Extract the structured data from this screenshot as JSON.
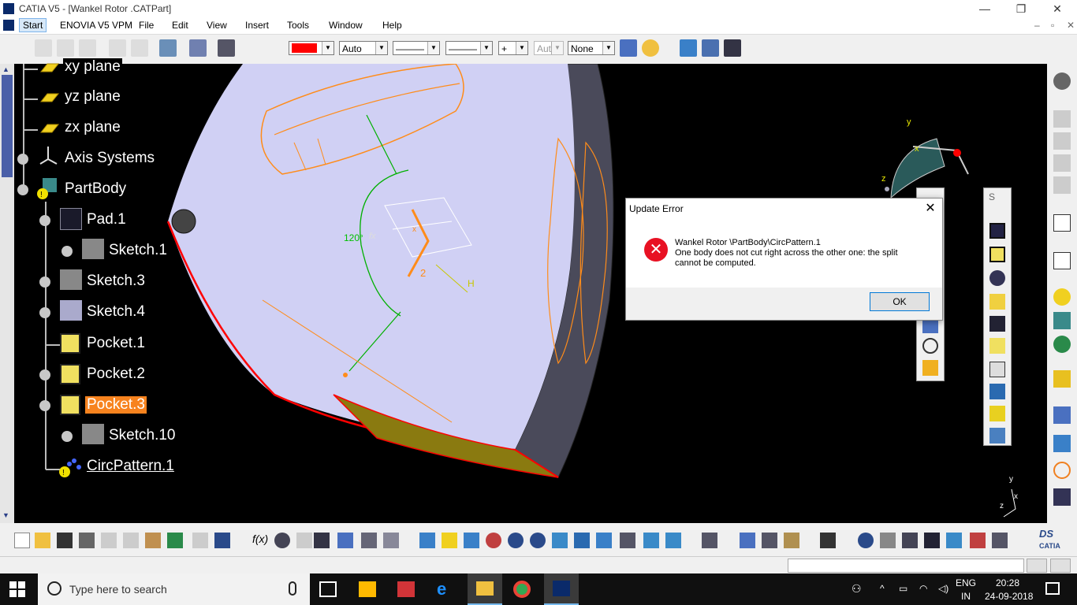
{
  "window": {
    "title": "CATIA V5 - [Wankel Rotor .CATPart]",
    "minimize": "—",
    "restore": "❐",
    "close": "✕"
  },
  "menu": {
    "items": [
      "Start",
      "ENOVIA V5 VPM",
      "File",
      "Edit",
      "View",
      "Insert",
      "Tools",
      "Window",
      "Help"
    ],
    "doc_controls": [
      "–",
      "▫",
      "✕"
    ]
  },
  "toolbar": {
    "color_combo": "",
    "color_swatch": "#ff0000",
    "transparency_combo": "Auto",
    "linetype_combo": "———",
    "thickness_combo": "———",
    "point_combo": "+",
    "layer_combo_disabled": "Aut",
    "layer_combo": "None"
  },
  "tree": {
    "items": [
      {
        "label": "xy plane",
        "icon": "plane-icon"
      },
      {
        "label": "yz plane",
        "icon": "plane-icon"
      },
      {
        "label": "zx plane",
        "icon": "plane-icon"
      },
      {
        "label": "Axis Systems",
        "icon": "axis-system-icon"
      },
      {
        "label": "PartBody",
        "icon": "partbody-icon"
      },
      {
        "label": "Pad.1",
        "icon": "pad-icon"
      },
      {
        "label": "Sketch.1",
        "icon": "sketch-icon"
      },
      {
        "label": "Sketch.3",
        "icon": "sketch-icon"
      },
      {
        "label": "Sketch.4",
        "icon": "sketch-icon"
      },
      {
        "label": "Pocket.1",
        "icon": "pocket-icon"
      },
      {
        "label": "Pocket.2",
        "icon": "pocket-icon"
      },
      {
        "label": "Pocket.3",
        "icon": "pocket-icon"
      },
      {
        "label": "Sketch.10",
        "icon": "sketch-icon"
      },
      {
        "label": "CircPattern.1",
        "icon": "circpattern-icon"
      }
    ]
  },
  "viewport": {
    "annotation_angle": "120°",
    "annotation_fx": "fx",
    "annotation_2": "2",
    "annotation_h": "H",
    "annotation_x": "x",
    "compass_x": "x",
    "compass_y": "y",
    "compass_z": "z",
    "axis_y": "y",
    "axis_x": "x",
    "axis_z": "z",
    "body_color": "#d0d0f4",
    "edge_color": "#ff0000",
    "sketch_color": "#ff8c1a"
  },
  "dialog": {
    "title": "Update Error",
    "close": "✕",
    "line1": "Wankel Rotor \\PartBody\\CircPattern.1",
    "line2": "One body does not cut right across the other one: the split",
    "line3": "cannot be computed.",
    "ok_label": "OK",
    "palette_letter": "S"
  },
  "taskbar": {
    "search_placeholder": "Type here to search",
    "lang": "ENG",
    "region": "IN",
    "time": "20:28",
    "date": "24-09-2018"
  },
  "bottombar": {
    "catia_logo": "CATIA"
  }
}
